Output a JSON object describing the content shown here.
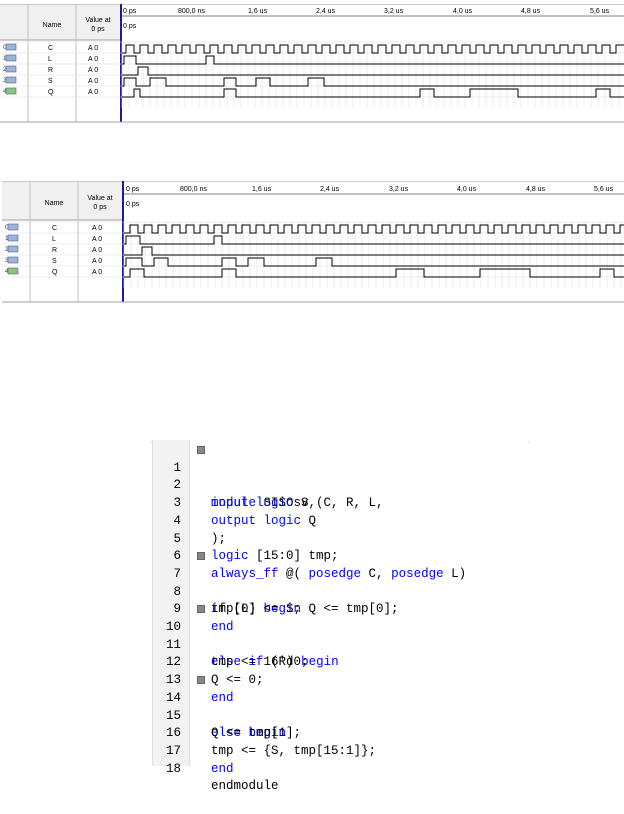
{
  "panels": [
    {
      "name_header": "Name",
      "value_header_line1": "Value at",
      "value_header_line2": "0 ps",
      "time_labels": [
        "0 ps",
        "800,0 ns",
        "1,6 us",
        "2,4 us",
        "3,2 us",
        "4,0 us",
        "4,8 us",
        "5,6 us"
      ],
      "cursor_label": "0 ps",
      "signals": [
        {
          "index": "0",
          "name": "C",
          "value": "A 0"
        },
        {
          "index": "1",
          "name": "L",
          "value": "A 0"
        },
        {
          "index": "2",
          "name": "R",
          "value": "A 0"
        },
        {
          "index": "3",
          "name": "S",
          "value": "A 0"
        },
        {
          "index": "4",
          "name": "Q",
          "value": "A 0"
        }
      ]
    },
    {
      "name_header": "Name",
      "value_header_line1": "Value at",
      "value_header_line2": "0 ps",
      "time_labels": [
        "0 ps",
        "800,0 ns",
        "1,6 us",
        "2,4 us",
        "3,2 us",
        "4,0 us",
        "4,8 us",
        "5,6 us"
      ],
      "cursor_label": "0 ps",
      "signals": [
        {
          "index": "0",
          "name": "C",
          "value": "A 0"
        },
        {
          "index": "1",
          "name": "L",
          "value": "A 0"
        },
        {
          "index": "2",
          "name": "R",
          "value": "A 0"
        },
        {
          "index": "3",
          "name": "S",
          "value": "A 0"
        },
        {
          "index": "4",
          "name": "Q",
          "value": "A 0"
        }
      ]
    }
  ],
  "code": {
    "line_numbers": [
      "1",
      "2",
      "3",
      "4",
      "5",
      "6",
      "7",
      "8",
      "9",
      "10",
      "11",
      "12",
      "13",
      "14",
      "15",
      "16",
      "17",
      "18"
    ],
    "line1": {
      "kw": "module",
      "rest": " SISOsv ("
    },
    "line2": {
      "kw1": "input",
      "kw2": "logic",
      "rest": " S, C, R, L,"
    },
    "line3": {
      "kw1": "output",
      "kw2": "logic",
      "rest": " Q"
    },
    "line4": {
      "rest": ");"
    },
    "line5": {
      "kw": "logic",
      "rest": " [15:0] tmp;"
    },
    "line6": {
      "kw1": "always_ff",
      "mid1": " @( ",
      "kw2": "posedge",
      "mid2": " C, ",
      "kw3": "posedge",
      "rest": " L)"
    },
    "line7": {
      "kw": "if",
      "mid": " (L) ",
      "kw2": "begin"
    },
    "line8": {
      "rest": "tmp[0] <= S; Q <= tmp[0];"
    },
    "line9": {
      "kw": "end"
    },
    "line10": {
      "kw": "else",
      "mid": " ",
      "kw2": "if",
      "mid2": " (R) ",
      "kw3": "begin"
    },
    "line11": {
      "rest": "tmp <= 16'd0;"
    },
    "line12": {
      "rest": "Q <= 0;"
    },
    "line13": {
      "kw": "end"
    },
    "line14": {
      "kw": "else",
      "mid": " ",
      "kw2": "begin"
    },
    "line15": {
      "rest": "Q <= tmp[1];"
    },
    "line16": {
      "rest": "tmp <= {S, tmp[15:1]};"
    },
    "line17": {
      "kw": "end"
    },
    "line18": {
      "rest": "endmodule"
    }
  }
}
